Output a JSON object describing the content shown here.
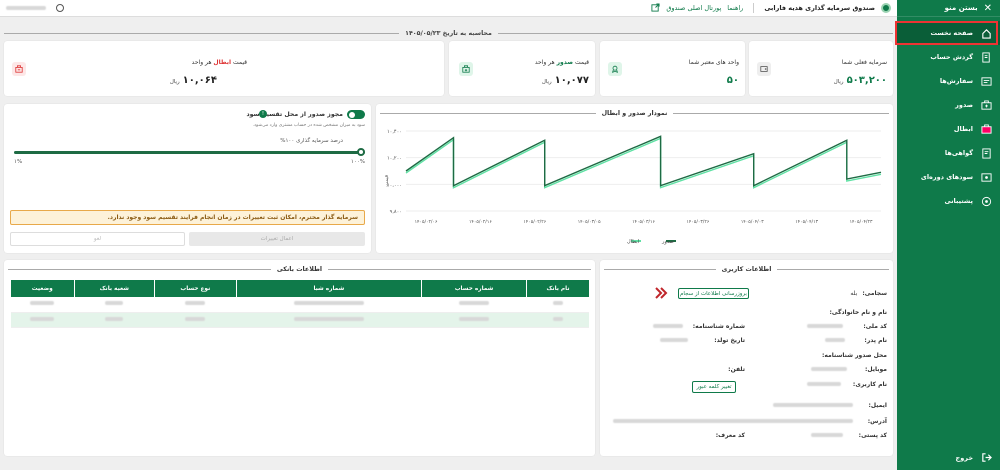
{
  "sidebar": {
    "close_label": "بستن منو",
    "items": [
      {
        "label": "صفحه نخست",
        "icon": "home-icon"
      },
      {
        "label": "گردش حساب",
        "icon": "account-flow-icon"
      },
      {
        "label": "سفارش‌ها",
        "icon": "orders-icon"
      },
      {
        "label": "صدور",
        "icon": "issue-icon"
      },
      {
        "label": "ابطال",
        "icon": "cancel-icon"
      },
      {
        "label": "گواهی‌ها",
        "icon": "certificate-icon"
      },
      {
        "label": "سودهای دوره‌ای",
        "icon": "profit-icon"
      },
      {
        "label": "پشتیبانی",
        "icon": "support-icon"
      }
    ],
    "logout_label": "خروج"
  },
  "header": {
    "fund_name": "صندوق سرمایه گذاری هدیه فارابی",
    "guide": "راهنما",
    "portal": "پورتال اصلی صندوق"
  },
  "calc_date": "محاسبه به تاریخ ۱۴۰۵/۰۵/۲۳",
  "cards": {
    "capital": {
      "label": "سرمایه فعلی شما",
      "value": "۵۰۳,۲۰۰",
      "unit": "ریال"
    },
    "units": {
      "label": "واحد های معتبر شما",
      "value": "۵۰"
    },
    "issue": {
      "label_pre": "قیمت",
      "label_bold": "صدور",
      "label_post": "هر واحد",
      "value": "۱۰,۰۷۷",
      "unit": "ریال"
    },
    "cancel": {
      "label_pre": "قیمت",
      "label_bold": "ابطال",
      "label_post": "هر واحد",
      "value": "۱۰,۰۶۴",
      "unit": "ریال"
    },
    "accent_red": "#d33",
    "accent_green": "#0f7a4a"
  },
  "chart_data": {
    "type": "line",
    "title": "نمودار صدور و ابطال",
    "ylabel": "قیمت",
    "yticks": [
      "۱۰,۴۰۰",
      "۱۰,۲۰۰",
      "۱۰,۰۰۰",
      "۹,۸۰۰"
    ],
    "ylim": [
      9800,
      10400
    ],
    "x": [
      "۱۴۰۵/۰۲/۰۶",
      "۱۴۰۵/۰۲/۱۶",
      "۱۴۰۵/۰۲/۲۶",
      "۱۴۰۵/۰۳/۰۵",
      "۱۴۰۵/۰۳/۱۶",
      "۱۴۰۵/۰۳/۲۶",
      "۱۴۰۵/۰۴/۰۳",
      "۱۴۰۵/۰۴/۱۳",
      "۱۴۰۵/۰۴/۲۳"
    ],
    "series": [
      {
        "name": "صدور",
        "color": "#1e6b44",
        "points": [
          [
            0,
            10100
          ],
          [
            2.5,
            10350
          ],
          [
            2.5,
            9990
          ],
          [
            7.3,
            10330
          ],
          [
            7.3,
            9990
          ],
          [
            13.4,
            10360
          ],
          [
            13.4,
            9990
          ],
          [
            18.3,
            10230
          ],
          [
            18.3,
            9990
          ],
          [
            23.2,
            10330
          ],
          [
            23.2,
            10040
          ],
          [
            25,
            10090
          ]
        ]
      },
      {
        "name": "ابطال",
        "color": "#5fe1a4",
        "points": [
          [
            0,
            10085
          ],
          [
            2.5,
            10335
          ],
          [
            2.5,
            9975
          ],
          [
            7.3,
            10315
          ],
          [
            7.3,
            9975
          ],
          [
            13.4,
            10345
          ],
          [
            13.4,
            9975
          ],
          [
            18.3,
            10215
          ],
          [
            18.3,
            9975
          ],
          [
            23.2,
            10315
          ],
          [
            23.2,
            10025
          ],
          [
            25,
            10075
          ]
        ]
      }
    ],
    "x_total": 25,
    "legend": "bottom"
  },
  "issue_panel": {
    "toggle_label": "مجوز صدور از محل تقسیم سود",
    "toggle_hint": "سود به میزان مشخص شده در حساب مشتری وارد می‌شود.",
    "slider_label": "درصد سرمایه گذاری ۱۰۰%",
    "slider_value": 100,
    "min_label": "۱%",
    "max_label": "۱۰۰%",
    "warning": "سرمایه گذار محترم، امکان ثبت تغییرات در زمان انجام فرایند تقسیم سود وجود ندارد.",
    "apply_label": "اعمال تغییرات",
    "cancel_label": "لغو"
  },
  "user_info": {
    "title": "اطلاعات کاربری",
    "sejami_label": "سجامی:",
    "sejami_value": "بله",
    "update_button": "بروزرسانی اطلاعات از سجام",
    "fullname_label": "نام و نام خانوادگی:",
    "national_label": "کد ملی:",
    "id_label": "شماره شناسنامه:",
    "father_label": "نام پدر:",
    "birth_label": "تاریخ تولد:",
    "issue_place_label": "محل صدور شناسنامه:",
    "mobile_label": "موبایل:",
    "phone_label": "تلفن:",
    "username_label": "نام کاربری:",
    "change_pw_button": "تغییر کلمه عبور",
    "email_label": "ایمیل:",
    "address_label": "آدرس:",
    "postal_label": "کد پستی:",
    "ref_label": "کد معرف:"
  },
  "bank_info": {
    "title": "اطلاعات بانکی",
    "columns": [
      "نام بانک",
      "شماره حساب",
      "شماره شبا",
      "نوع حساب",
      "شعبه بانک",
      "وضعیت"
    ]
  }
}
